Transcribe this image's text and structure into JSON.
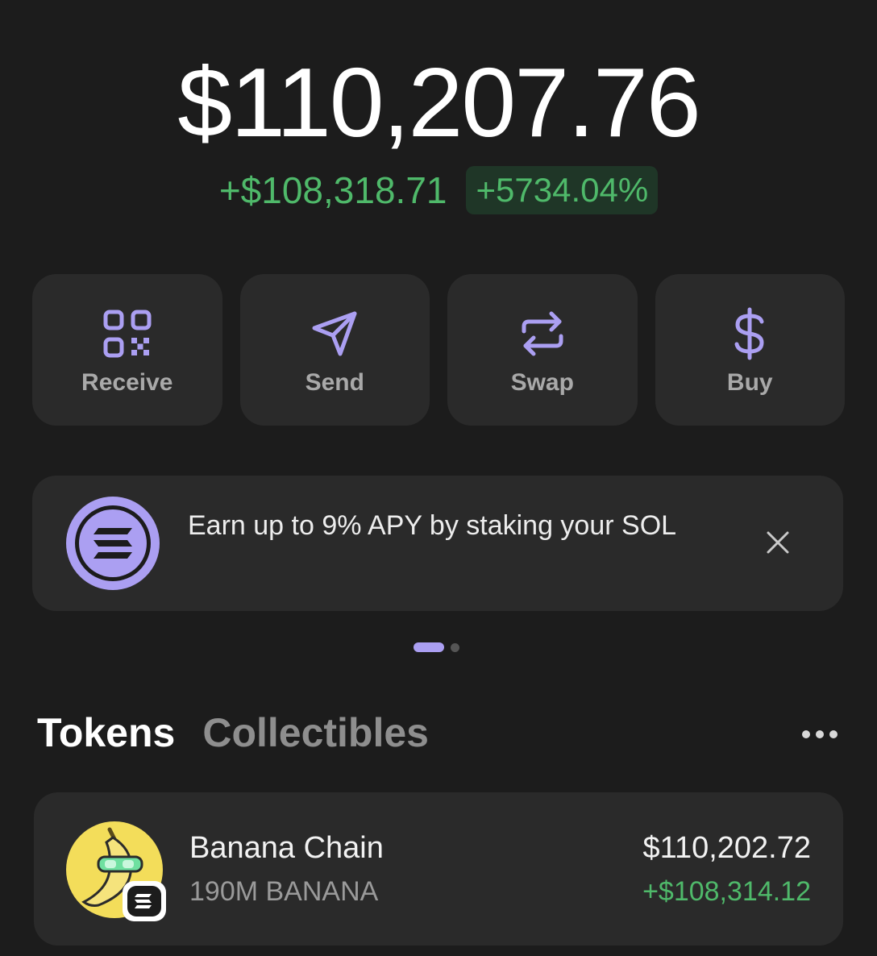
{
  "balance": {
    "total": "$110,207.76",
    "change_amount": "+$108,318.71",
    "change_percent": "+5734.04%"
  },
  "actions": [
    {
      "label": "Receive",
      "icon": "qr-code-icon"
    },
    {
      "label": "Send",
      "icon": "send-icon"
    },
    {
      "label": "Swap",
      "icon": "swap-icon"
    },
    {
      "label": "Buy",
      "icon": "dollar-icon"
    }
  ],
  "promo": {
    "text": "Earn up to 9% APY by staking your SOL",
    "icon": "solana-icon",
    "close_icon": "close-icon"
  },
  "carousel": {
    "active_index": 0,
    "count": 2
  },
  "tabs": [
    {
      "label": "Tokens",
      "active": true
    },
    {
      "label": "Collectibles",
      "active": false
    }
  ],
  "more_icon": "more-icon",
  "tokens": [
    {
      "name": "Banana Chain",
      "amount": "190M BANANA",
      "value": "$110,202.72",
      "change": "+$108,314.12",
      "icon": "banana-token-icon",
      "chain_badge": "solana-icon"
    }
  ],
  "colors": {
    "background": "#1c1c1c",
    "card": "#2a2a2a",
    "accent": "#ab9ff2",
    "positive": "#4fb96a"
  }
}
